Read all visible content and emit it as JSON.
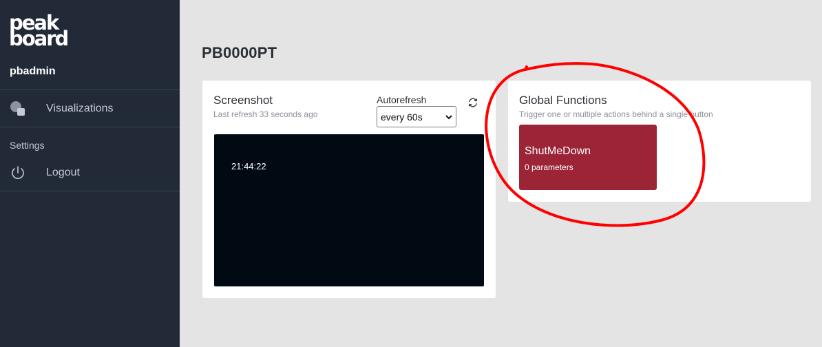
{
  "brand": {
    "logo_text_line1": "peak",
    "logo_text_line2": "board"
  },
  "sidebar": {
    "username": "pbadmin",
    "items": [
      {
        "label": "Visualizations",
        "icon": "visualizations-icon"
      },
      {
        "label": "Logout",
        "icon": "power-icon"
      }
    ],
    "section_settings": "Settings"
  },
  "page": {
    "title": "PB0000PT"
  },
  "screenshot_card": {
    "title": "Screenshot",
    "subtitle": "Last refresh 33 seconds ago",
    "autorefresh_label": "Autorefresh",
    "autorefresh_value": "every 60s",
    "screen_time": "21:44:22"
  },
  "functions_card": {
    "title": "Global Functions",
    "subtitle": "Trigger one or multiple actions behind a single button",
    "functions": [
      {
        "name": "ShutMeDown",
        "params": "0 parameters"
      }
    ]
  },
  "colors": {
    "sidebar_bg": "#222a37",
    "page_bg": "#e4e4e4",
    "function_tile": "#9b2537",
    "screen_bg": "#010a12",
    "annotation": "#ff0000"
  }
}
